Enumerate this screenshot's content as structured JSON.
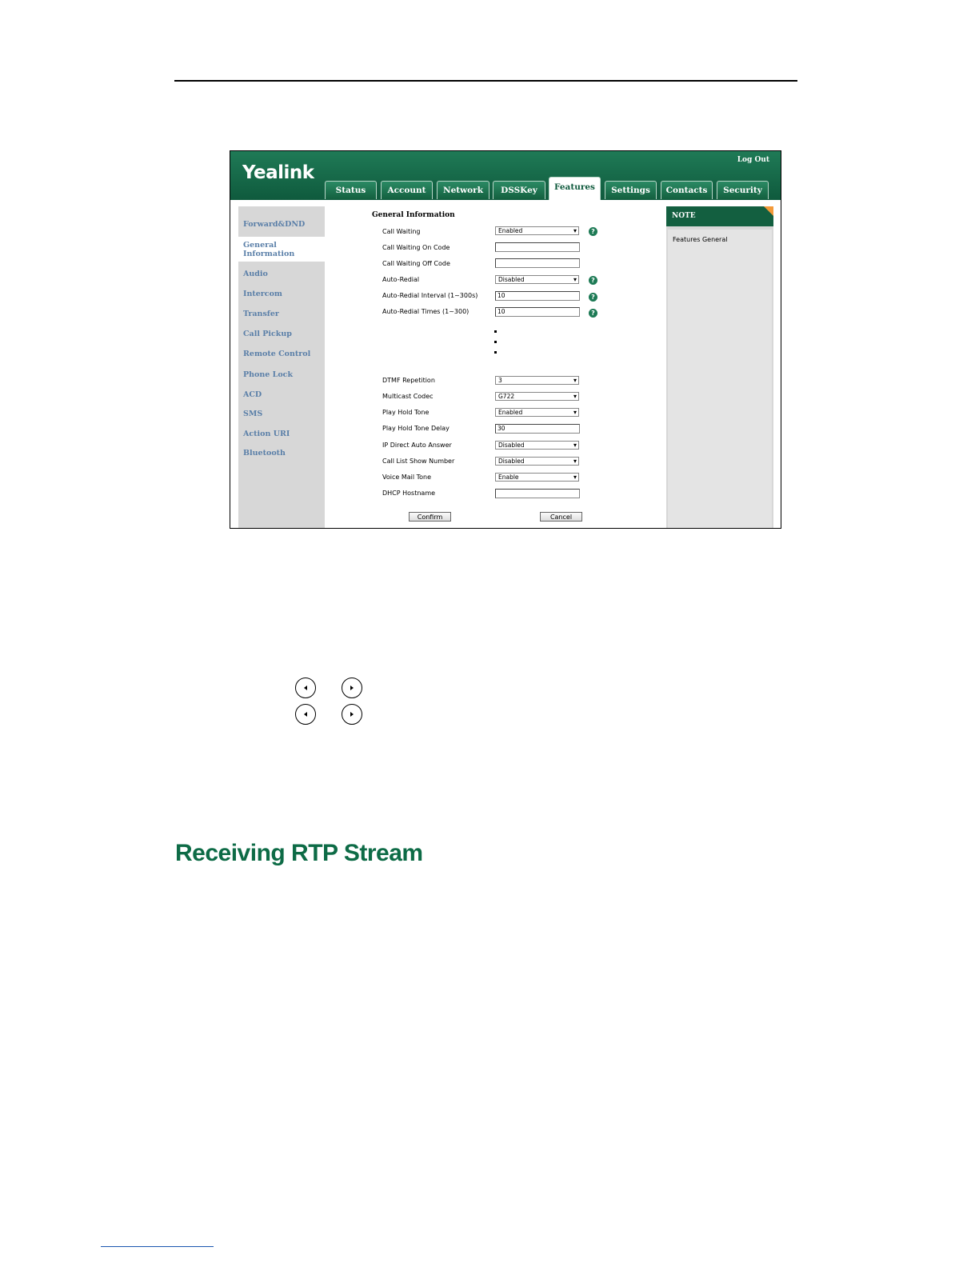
{
  "app": {
    "logo": "Yealink",
    "logout": "Log Out"
  },
  "tabs": [
    "Status",
    "Account",
    "Network",
    "DSSKey",
    "Features",
    "Settings",
    "Contacts",
    "Security"
  ],
  "active_tab": "Features",
  "sidebar": {
    "items": [
      "Forward&DND",
      "General Information",
      "Audio",
      "Intercom",
      "Transfer",
      "Call Pickup",
      "Remote Control",
      "Phone Lock",
      "ACD",
      "SMS",
      "Action URI",
      "Bluetooth"
    ],
    "active_item_line1": "General",
    "active_item_line2": "Information"
  },
  "form": {
    "title": "General Information",
    "fields": [
      {
        "label": "Call Waiting",
        "type": "select",
        "value": "Enabled",
        "help": true
      },
      {
        "label": "Call Waiting On Code",
        "type": "input",
        "value": ""
      },
      {
        "label": "Call Waiting Off Code",
        "type": "input",
        "value": ""
      },
      {
        "label": "Auto-Redial",
        "type": "select",
        "value": "Disabled",
        "help": true
      },
      {
        "label": "Auto-Redial Interval (1~300s)",
        "type": "input",
        "value": "10",
        "help": true
      },
      {
        "label": "Auto-Redial Times (1~300)",
        "type": "input",
        "value": "10",
        "help": true
      },
      {
        "label": "DTMF Repetition",
        "type": "select",
        "value": "3"
      },
      {
        "label": "Multicast Codec",
        "type": "select",
        "value": "G722"
      },
      {
        "label": "Play Hold Tone",
        "type": "select",
        "value": "Enabled"
      },
      {
        "label": "Play Hold Tone Delay",
        "type": "input",
        "value": "30"
      },
      {
        "label": "IP Direct Auto Answer",
        "type": "select",
        "value": "Disabled"
      },
      {
        "label": "Call List Show Number",
        "type": "select",
        "value": "Disabled"
      },
      {
        "label": "Voice Mail Tone",
        "type": "select",
        "value": "Enable"
      },
      {
        "label": "DHCP Hostname",
        "type": "input",
        "value": ""
      }
    ],
    "help_glyph": "?",
    "confirm_label": "Confirm",
    "cancel_label": "Cancel"
  },
  "note": {
    "title": "NOTE",
    "text": "Features General"
  },
  "section_heading": "Receiving RTP Stream",
  "colors": {
    "brand_green": "#0f5a3d",
    "heading_green": "#0d6b46",
    "sidebar_link": "#5a7fa8",
    "note_corner": "#f39a3a"
  }
}
